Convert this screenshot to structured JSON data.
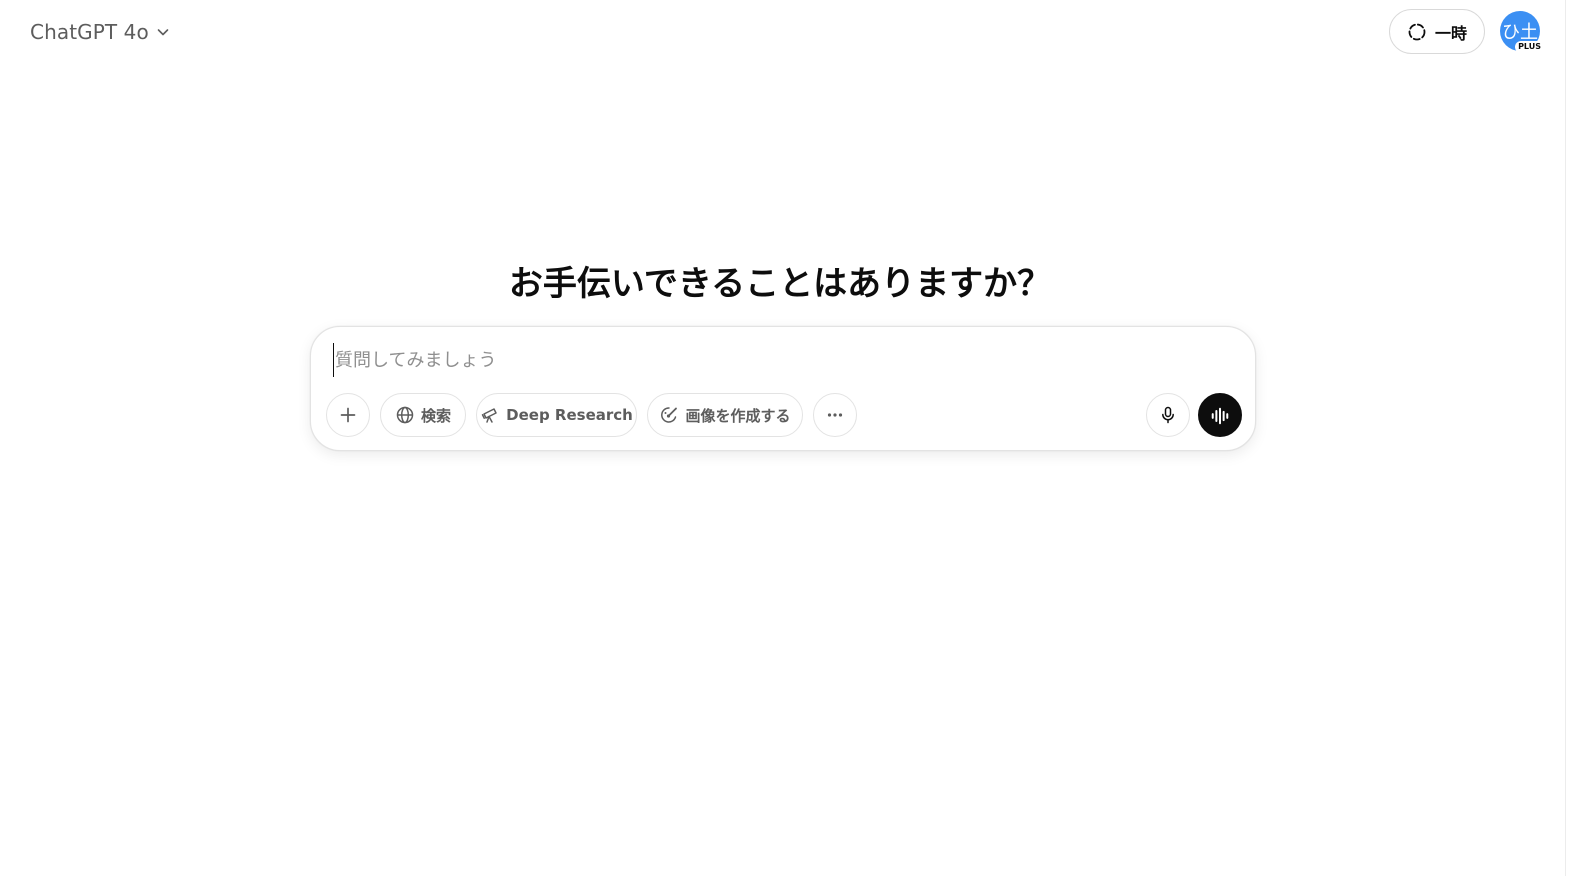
{
  "header": {
    "model_name": "ChatGPT 4o",
    "temp_chat_label": "一時",
    "avatar_initials": "ひ土",
    "plan_badge": "PLUS"
  },
  "main": {
    "headline": "お手伝いできることはありますか？"
  },
  "composer": {
    "placeholder": "質問してみましょう",
    "tools": {
      "search_label": "検索",
      "deep_research_label": "Deep Research",
      "create_image_label": "画像を作成する"
    }
  },
  "icons": {
    "model_chevron": "chevron-down-icon",
    "temp_chat": "dashed-circle-icon",
    "attach": "plus-icon",
    "search": "globe-icon",
    "deep_research": "telescope-icon",
    "create_image": "paintbrush-icon",
    "more": "ellipsis-icon",
    "dictate": "microphone-icon",
    "voice_mode": "waveform-icon"
  },
  "colors": {
    "avatar_bg": "#3b8ff3",
    "voice_button_bg": "#0d0d0d",
    "border": "#e3e3e3"
  }
}
